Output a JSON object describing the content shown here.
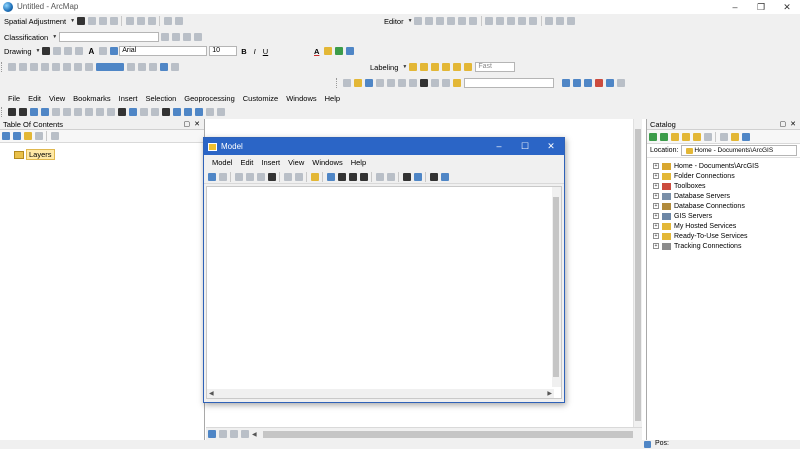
{
  "window": {
    "title": "Untitled - ArcMap",
    "minimize": "–",
    "restore": "❐",
    "close": "✕"
  },
  "toolbars": {
    "spatial_adjustment": "Spatial Adjustment",
    "editor": "Editor",
    "classification": "Classification",
    "drawing": "Drawing",
    "font": "Arial",
    "font_size": "10",
    "bold": "B",
    "italic": "I",
    "underline": "U",
    "text_tool": "A",
    "labeling": "Labeling",
    "fast": "Fast"
  },
  "menu": [
    "File",
    "Edit",
    "View",
    "Bookmarks",
    "Insert",
    "Selection",
    "Geoprocessing",
    "Customize",
    "Windows",
    "Help"
  ],
  "toc": {
    "title": "Table Of Contents",
    "layers_label": "Layers"
  },
  "catalog": {
    "title": "Catalog",
    "location_label": "Location:",
    "location_value": "Home - Documents\\ArcGIS",
    "items": [
      {
        "label": "Home - Documents\\ArcGIS",
        "icon": "home-folder-icon",
        "color": "#d9a72f"
      },
      {
        "label": "Folder Connections",
        "icon": "folder-connections-icon",
        "color": "#e3b736"
      },
      {
        "label": "Toolboxes",
        "icon": "toolbox-icon",
        "color": "#cc4b3e"
      },
      {
        "label": "Database Servers",
        "icon": "database-server-icon",
        "color": "#7a8fa8"
      },
      {
        "label": "Database Connections",
        "icon": "database-connection-icon",
        "color": "#b28b3c"
      },
      {
        "label": "GIS Servers",
        "icon": "gis-server-icon",
        "color": "#6d87a6"
      },
      {
        "label": "My Hosted Services",
        "icon": "hosted-services-icon",
        "color": "#e3b736"
      },
      {
        "label": "Ready-To-Use Services",
        "icon": "ready-services-icon",
        "color": "#e3b736"
      },
      {
        "label": "Tracking Connections",
        "icon": "tracking-connection-icon",
        "color": "#8c8c8c"
      }
    ]
  },
  "model": {
    "title": "Model",
    "menu": [
      "Model",
      "Edit",
      "Insert",
      "View",
      "Windows",
      "Help"
    ],
    "minimize": "–",
    "maximize": "☐",
    "close": "✕"
  },
  "status": {
    "position_label": "Pos:"
  },
  "colors": {
    "accent": "#2b65c6",
    "panel_bg": "#f0f0f0"
  }
}
